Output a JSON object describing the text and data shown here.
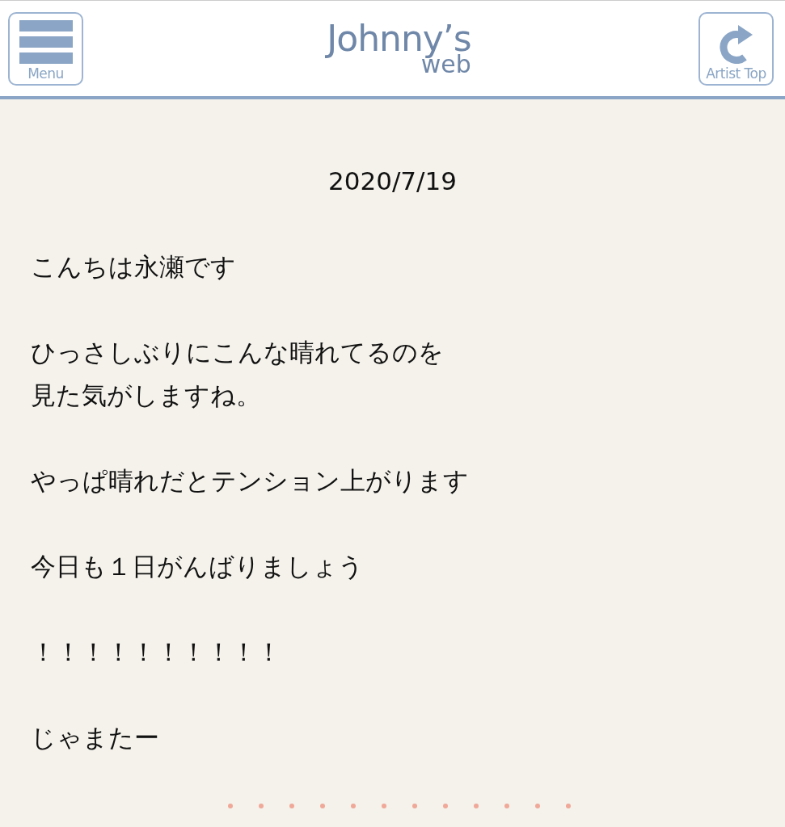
{
  "header": {
    "menu_button": {
      "label": "Menu"
    },
    "logo": {
      "title": "Johnny’s",
      "subtitle": "web"
    },
    "artist_top_button": {
      "label": "Artist Top"
    }
  },
  "post": {
    "date": "2020/7/19",
    "paragraphs": [
      [
        "こんちは永瀬です"
      ],
      [
        "ひっさしぶりにこんな晴れてるのを",
        "見た気がしますね。"
      ],
      [
        "やっぱ晴れだとテンション上がります"
      ],
      [
        "今日も１日がんばりましょう"
      ],
      [
        "！！！！！！！！！！"
      ],
      [
        "じゃまたー"
      ]
    ]
  }
}
